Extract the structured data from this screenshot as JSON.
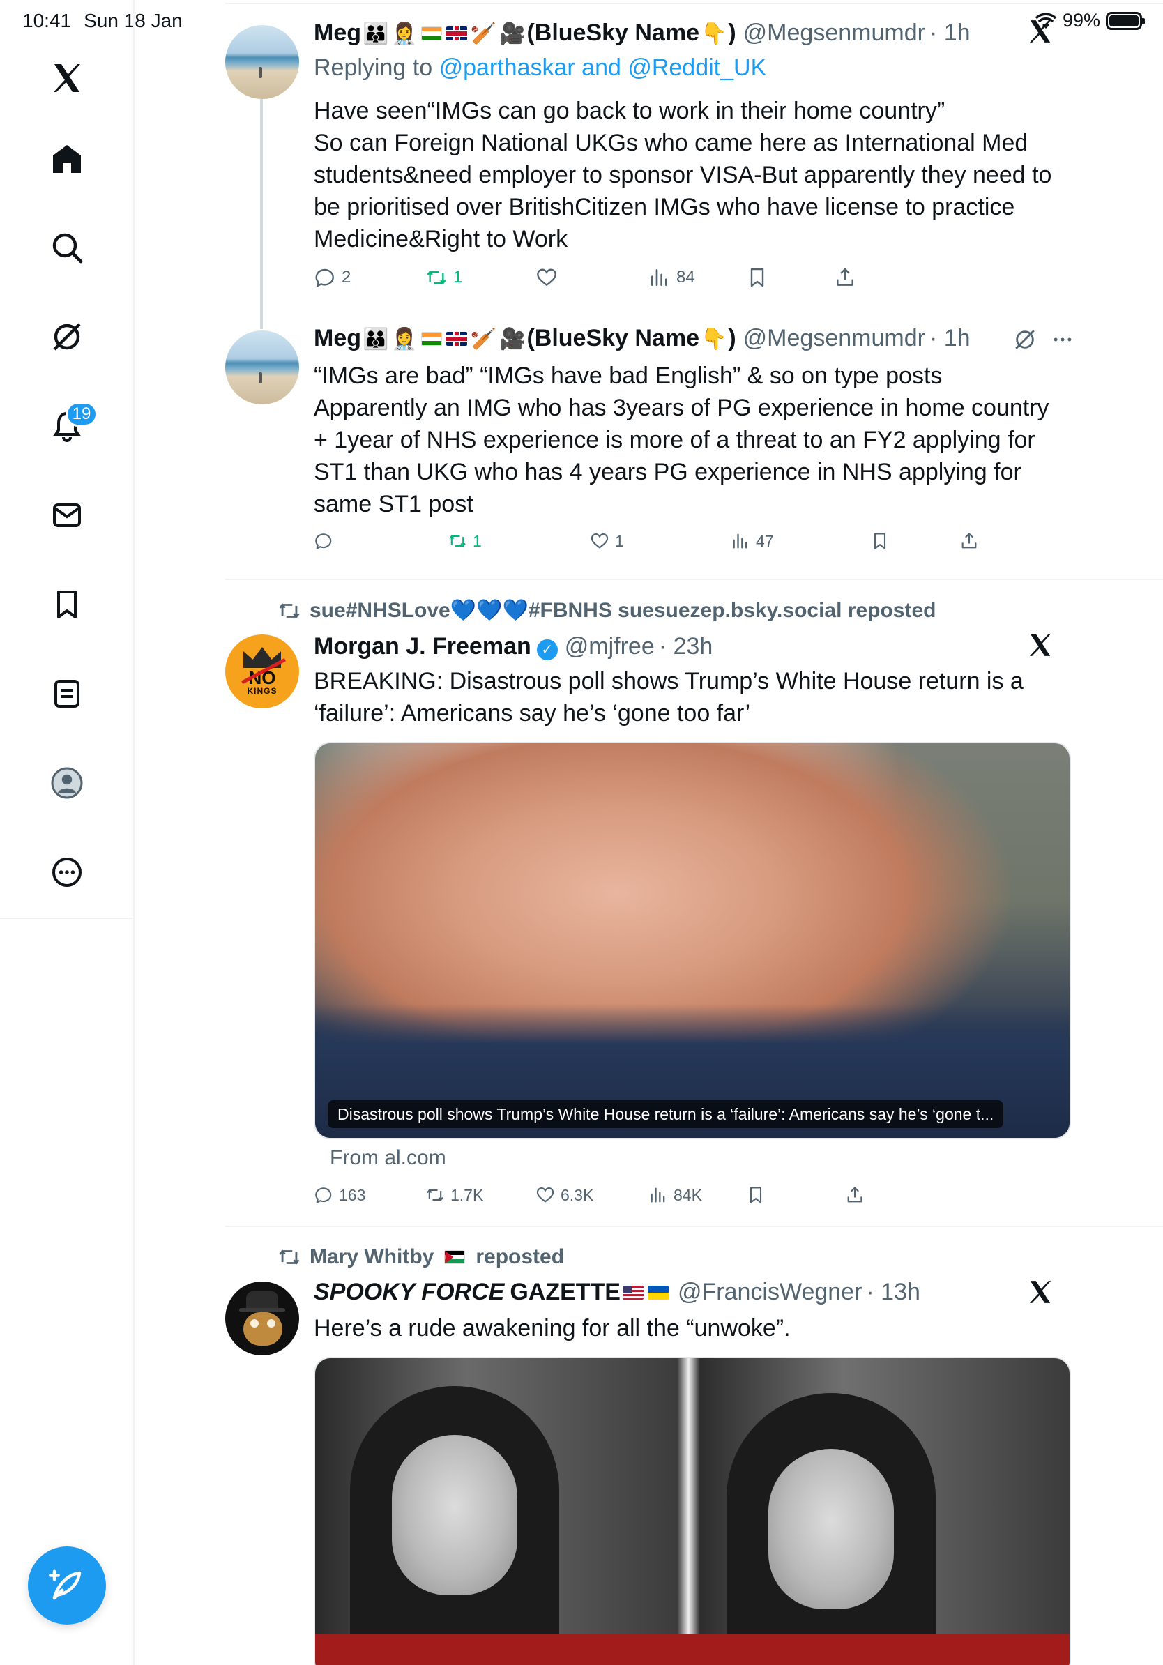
{
  "status_bar": {
    "time": "10:41",
    "date": "Sun 18 Jan",
    "battery": "99%"
  },
  "sidebar": {
    "items": [
      {
        "name": "x-logo-icon"
      },
      {
        "name": "home-icon"
      },
      {
        "name": "search-icon"
      },
      {
        "name": "grok-icon"
      },
      {
        "name": "notifications-icon",
        "badge": "19"
      },
      {
        "name": "messages-icon"
      },
      {
        "name": "bookmarks-icon"
      },
      {
        "name": "lists-icon"
      },
      {
        "name": "profile-icon"
      },
      {
        "name": "more-icon"
      }
    ],
    "compose_icon": "compose-post-icon"
  },
  "tweets": [
    {
      "name": "Meg",
      "display_suffix": "(BlueSky Name",
      "display_close": ")",
      "handle": "@Megsenmumdr",
      "time": "· 1h",
      "reply_prefix": "Replying to",
      "reply_to": "@parthaskar and @Reddit_UK",
      "text": [
        "Have seen“IMGs can go back to work in their home country”",
        "So can Foreign National UKGs who came here as International Med",
        "students&need employer to sponsor VISA-But apparently they need to",
        "be prioritised over BritishCitizen IMGs who have license to practice",
        "Medicine&Right to Work"
      ],
      "replies": "2",
      "retweets": "1",
      "likes": "",
      "views": "84"
    },
    {
      "name": "Meg",
      "display_suffix": "(BlueSky Name",
      "display_close": ")",
      "handle": "@Megsenmumdr",
      "time": "· 1h",
      "text": [
        "“IMGs are bad” “IMGs have bad English” & so on type posts",
        "Apparently an IMG who has 3years of PG experience in home country",
        "+ 1year of NHS experience is more of a threat to an FY2 applying for",
        "ST1 than UKG who has 4 years PG experience in NHS applying for",
        "same ST1 post"
      ],
      "replies": "",
      "retweets": "1",
      "likes": "1",
      "views": "47"
    },
    {
      "reposted_by_a": "sue#NHSLove",
      "reposted_by_b": "#FBNHS suesuezep.bsky.social reposted",
      "name": "Morgan J. Freeman",
      "handle": "@mjfree",
      "time": "· 23h",
      "text": [
        "BREAKING: Disastrous poll shows Trump’s White House return is a",
        "‘failure’: Americans say he’s ‘gone too far’"
      ],
      "card_caption": "Disastrous poll shows Trump’s White House return is a ‘failure’: Americans say he’s ‘gone t...",
      "card_source": "From al.com",
      "replies": "163",
      "retweets": "1.7K",
      "likes": "6.3K",
      "views": "84K"
    },
    {
      "reposted_by": "Mary Whitby",
      "reposted_suffix": "reposted",
      "name_italic": "SPOOKY FORCE",
      "name_rest": "GAZETTE",
      "handle": "@FrancisWegner",
      "time": "· 13h",
      "text": [
        "Here’s a rude awakening for all the “unwoke”."
      ]
    }
  ]
}
